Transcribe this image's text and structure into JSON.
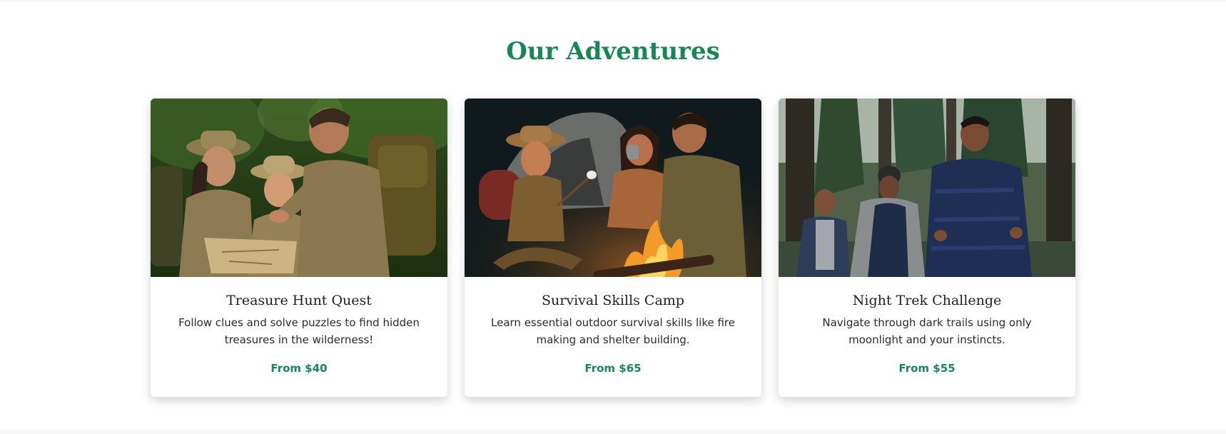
{
  "section": {
    "title": "Our Adventures",
    "accent_color": "#198754"
  },
  "cards": [
    {
      "title": "Treasure Hunt Quest",
      "description": "Follow clues and solve puzzles to find hidden treasures in the wilderness!",
      "price": "From $40",
      "image": "family-reading-treasure-map-in-jungle"
    },
    {
      "title": "Survival Skills Camp",
      "description": "Learn essential outdoor survival skills like fire making and shelter building.",
      "price": "From $65",
      "image": "family-around-campfire-by-tent"
    },
    {
      "title": "Night Trek Challenge",
      "description": "Navigate through dark trails using only moonlight and your instincts.",
      "price": "From $55",
      "image": "hikers-walking-through-forest"
    }
  ]
}
